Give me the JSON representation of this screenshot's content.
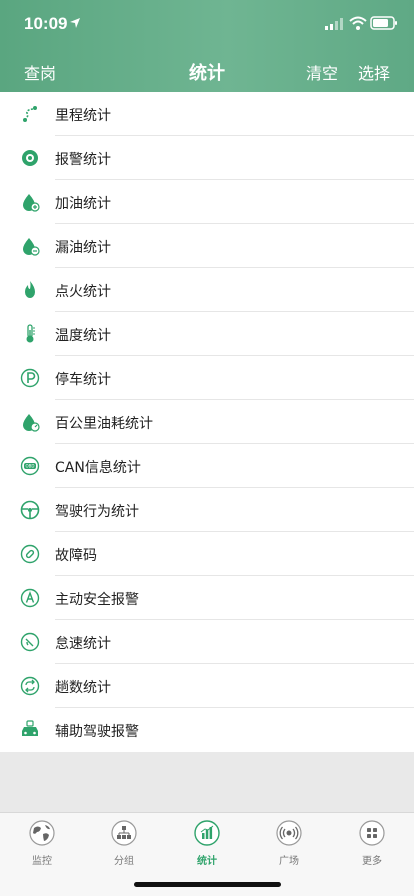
{
  "status_bar": {
    "time": "10:09"
  },
  "nav": {
    "left": "查岗",
    "title": "统计",
    "clear": "清空",
    "select": "选择"
  },
  "items": [
    {
      "label": "里程统计",
      "icon": "route-icon"
    },
    {
      "label": "报警统计",
      "icon": "alarm-icon"
    },
    {
      "label": "加油统计",
      "icon": "fuel-add-icon"
    },
    {
      "label": "漏油统计",
      "icon": "fuel-leak-icon"
    },
    {
      "label": "点火统计",
      "icon": "fire-icon"
    },
    {
      "label": "温度统计",
      "icon": "thermometer-icon"
    },
    {
      "label": "停车统计",
      "icon": "parking-icon"
    },
    {
      "label": "百公里油耗统计",
      "icon": "fuel-consumption-icon"
    },
    {
      "label": "CAN信息统计",
      "icon": "obd-icon"
    },
    {
      "label": "驾驶行为统计",
      "icon": "steering-wheel-icon"
    },
    {
      "label": "故障码",
      "icon": "fault-code-icon"
    },
    {
      "label": "主动安全报警",
      "icon": "active-safety-icon"
    },
    {
      "label": "怠速统计",
      "icon": "idle-speed-icon"
    },
    {
      "label": "趟数统计",
      "icon": "trip-count-icon"
    },
    {
      "label": "辅助驾驶报警",
      "icon": "assisted-driving-icon"
    }
  ],
  "tabbar": {
    "tabs": [
      {
        "label": "监控",
        "icon": "globe-icon"
      },
      {
        "label": "分组",
        "icon": "group-icon"
      },
      {
        "label": "统计",
        "icon": "stats-icon"
      },
      {
        "label": "广场",
        "icon": "broadcast-icon"
      },
      {
        "label": "更多",
        "icon": "more-grid-icon"
      }
    ],
    "active_label": "统计"
  },
  "colors": {
    "accent": "#2fa36b",
    "header": "#5fa985"
  }
}
